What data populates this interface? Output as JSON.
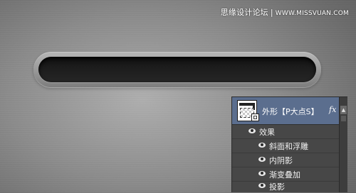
{
  "watermark": {
    "site_name": "思缘设计论坛",
    "separator": "|",
    "url": "WWW.MISSVUAN.COM"
  },
  "progress_slot": {
    "fill_fraction": 0
  },
  "layers_panel": {
    "layer": {
      "name": "外形【P大点S】",
      "fx_label": "fx",
      "thumbnail_icon": "shape-layer-thumbnail",
      "badge_icon": "vector-mask-icon"
    },
    "effects_header": "效果",
    "effects": [
      "斜面和浮雕",
      "内阴影",
      "渐变叠加",
      "投影"
    ],
    "scroll_icon": "scroll-up-arrow-icon"
  },
  "colors": {
    "layer_selected_bg": "#5b6e8e",
    "panel_bg": "#474747",
    "slot_inner": "#1c1c1c"
  }
}
